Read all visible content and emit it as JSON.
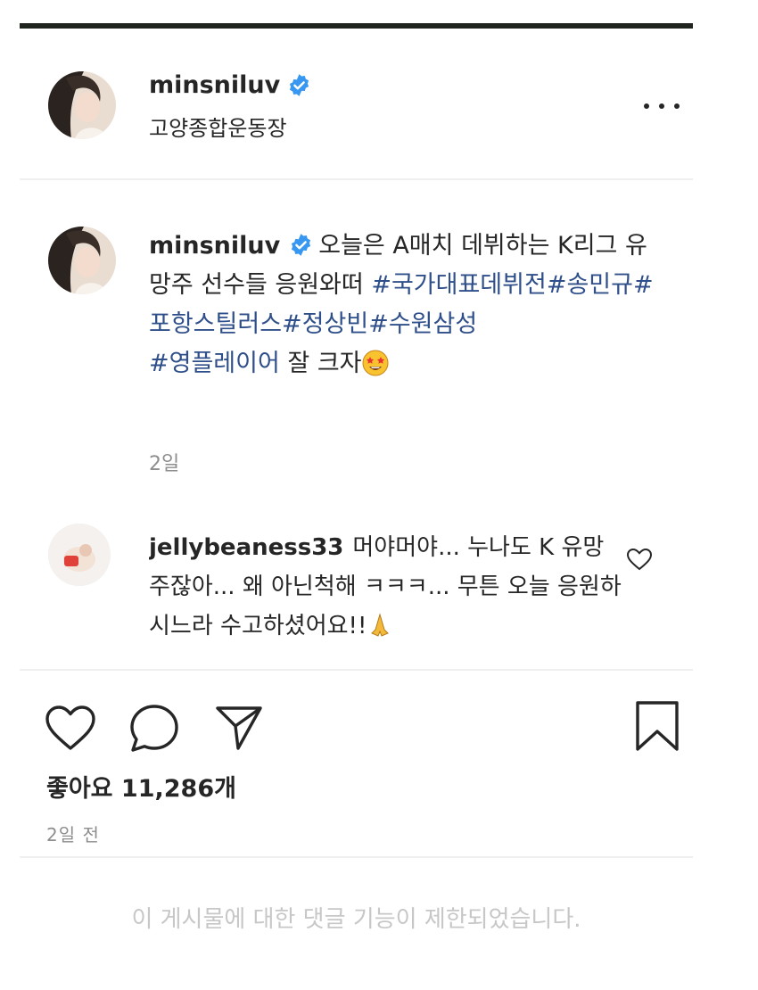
{
  "post": {
    "username": "minsniluv",
    "location": "고양종합운동장",
    "caption": {
      "text": "오늘은 A매치 데뷔하는 K리그 유망주 선수들 응원와떠",
      "hashtags": [
        "#국가대표데뷔전",
        "#송민규",
        "#포항스틸러스",
        "#정상빈",
        "#수원삼성",
        "#영플레이어"
      ],
      "tail": "잘 크자",
      "time": "2일"
    },
    "comment": {
      "username": "jellybeaness33",
      "text": "머야머야... 누나도 K 유망주잖아... 왜 아닌척해 ㅋㅋㅋ... 무튼 오늘 응원하시느라 수고하셨어요!!"
    },
    "likes_label": "좋아요 11,286개",
    "time_ago": "2일 전",
    "comments_disabled": "이 게시물에 대한 댓글 기능이 제한되었습니다."
  },
  "icons": {
    "verified": "verified-badge-icon",
    "more": "more-options-icon",
    "like": "heart-icon",
    "comment": "comment-bubble-icon",
    "share": "paper-plane-icon",
    "save": "bookmark-icon",
    "emoji": "star-struck-emoji"
  },
  "colors": {
    "hashtag": "#2f4f8a",
    "verified": "#3897f0",
    "muted": "#8e8e8e",
    "disabled_text": "#c7c7c7"
  }
}
